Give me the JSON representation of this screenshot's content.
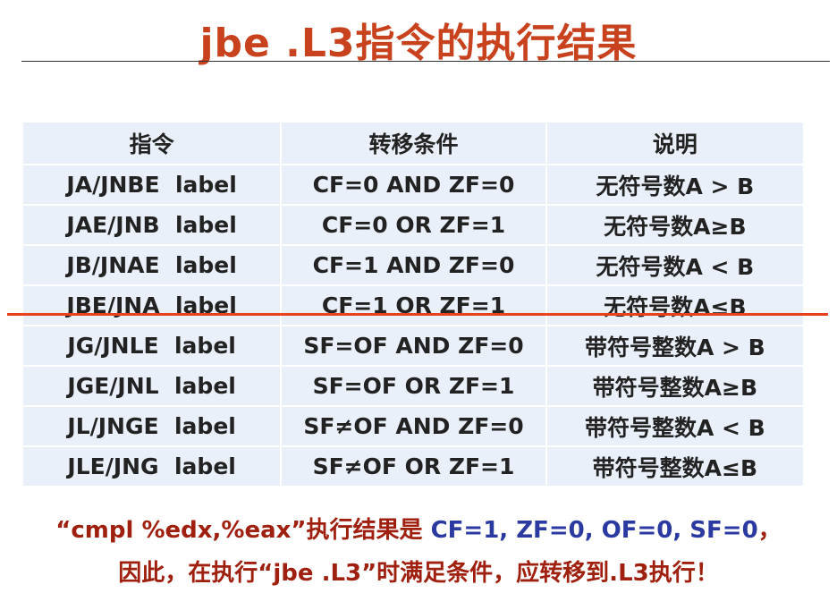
{
  "title": "jbe .L3指令的执行结果",
  "table": {
    "headers": [
      "指令",
      "转移条件",
      "说明"
    ],
    "rows": [
      [
        "JA/JNBE  label",
        "CF=0 AND ZF=0",
        "无符号数A > B"
      ],
      [
        "JAE/JNB  label",
        "CF=0 OR ZF=1",
        "无符号数A≥B"
      ],
      [
        "JB/JNAE  label",
        "CF=1 AND ZF=0",
        "无符号数A < B"
      ],
      [
        "JBE/JNA  label",
        "CF=1 OR ZF=1",
        "无符号数A≤B"
      ],
      [
        "JG/JNLE  label",
        "SF=OF AND ZF=0",
        "带符号整数A > B"
      ],
      [
        "JGE/JNL  label",
        "SF=OF OR ZF=1",
        "带符号整数A≥B"
      ],
      [
        "JL/JNGE  label",
        "SF≠OF AND ZF=0",
        "带符号整数A < B"
      ],
      [
        "JLE/JNG  label",
        "SF≠OF OR ZF=1",
        "带符号整数A≤B"
      ]
    ]
  },
  "summary": {
    "line1_prefix": "“cmpl %edx,%eax”执行结果是 ",
    "line1_flags": "CF=1, ZF=0, OF=0, SF=0",
    "line1_suffix": "，",
    "line2": "因此，在执行“jbe .L3”时满足条件，应转移到.L3执行！"
  },
  "colors": {
    "title": "#c8421e",
    "accent_line": "#e8421c",
    "summary_text": "#a0200f",
    "flags_text": "#2a3aa0",
    "table_bg": "#e9f0fa"
  }
}
